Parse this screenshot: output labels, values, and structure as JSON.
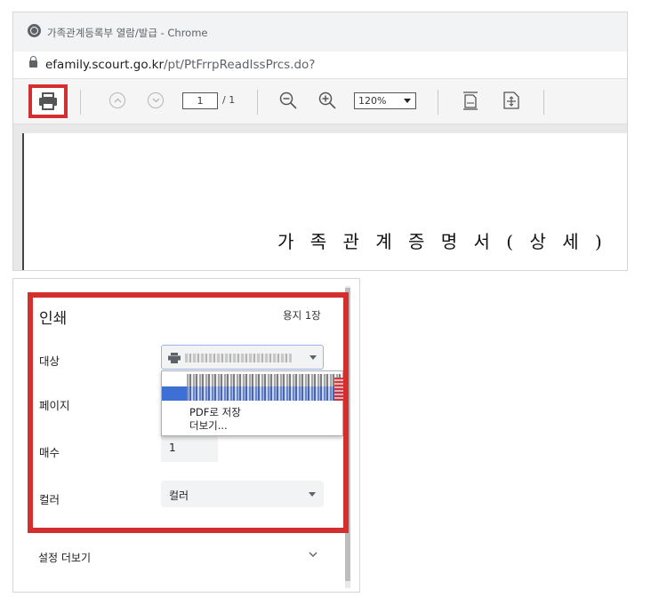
{
  "browser": {
    "window_title": "가족관계등록부 열람/발급 - Chrome",
    "url_domain": "efamily.scourt.go.kr",
    "url_path": "/pt/PtFrrpReadIssPrcs.do?"
  },
  "pdf_toolbar": {
    "current_page": "1",
    "total_pages": "/ 1",
    "zoom_level": "120%",
    "icons": [
      "print-icon",
      "previous-page-icon",
      "next-page-icon",
      "zoom-out-icon",
      "zoom-in-icon",
      "fit-width-icon",
      "fit-page-icon"
    ]
  },
  "document": {
    "heading": "가 족 관 계 증 명 서 ( 상 세 )"
  },
  "print_dialog": {
    "title": "인쇄",
    "sheet_count": "용지 1장",
    "destination_label": "대상",
    "pages_label": "페이지",
    "copies_label": "매수",
    "copies_value": "1",
    "color_label": "컬러",
    "color_value": "컬러",
    "dropdown_options": [
      "PDF로 저장",
      "더보기..."
    ],
    "more_settings": "설정 더보기"
  },
  "colors": {
    "highlight_red": "#d32f2f",
    "selected_blue": "#3d6fd4"
  }
}
